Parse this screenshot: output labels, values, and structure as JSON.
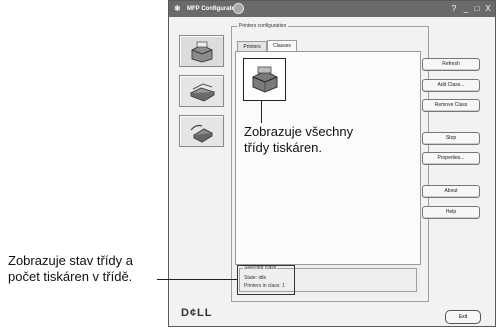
{
  "window": {
    "title": "MFP Configurator",
    "controls": [
      "?",
      "_",
      "□",
      "X"
    ]
  },
  "group": {
    "label": "Printers configuration"
  },
  "tabs": [
    {
      "label": "Printers",
      "active": false
    },
    {
      "label": "Classes",
      "active": true
    }
  ],
  "selected": {
    "legend": "Selected class",
    "state": "State: idle",
    "printers": "Printers in class: 1"
  },
  "buttons": {
    "refresh": "Refresh",
    "add": "Add Class...",
    "remove": "Remove Class",
    "stop": "Stop",
    "properties": "Properties...",
    "about": "About",
    "help": "Help",
    "exit": "Exit"
  },
  "logo": "D¢LL",
  "annotations": {
    "classes_line1": "Zobrazuje všechny",
    "classes_line2": "třídy tiskáren.",
    "status_line1": "Zobrazuje stav třídy a",
    "status_line2": "počet tiskáren v třídě."
  },
  "nav_icons": [
    "printer-icon",
    "scanner-icon",
    "port-icon"
  ]
}
